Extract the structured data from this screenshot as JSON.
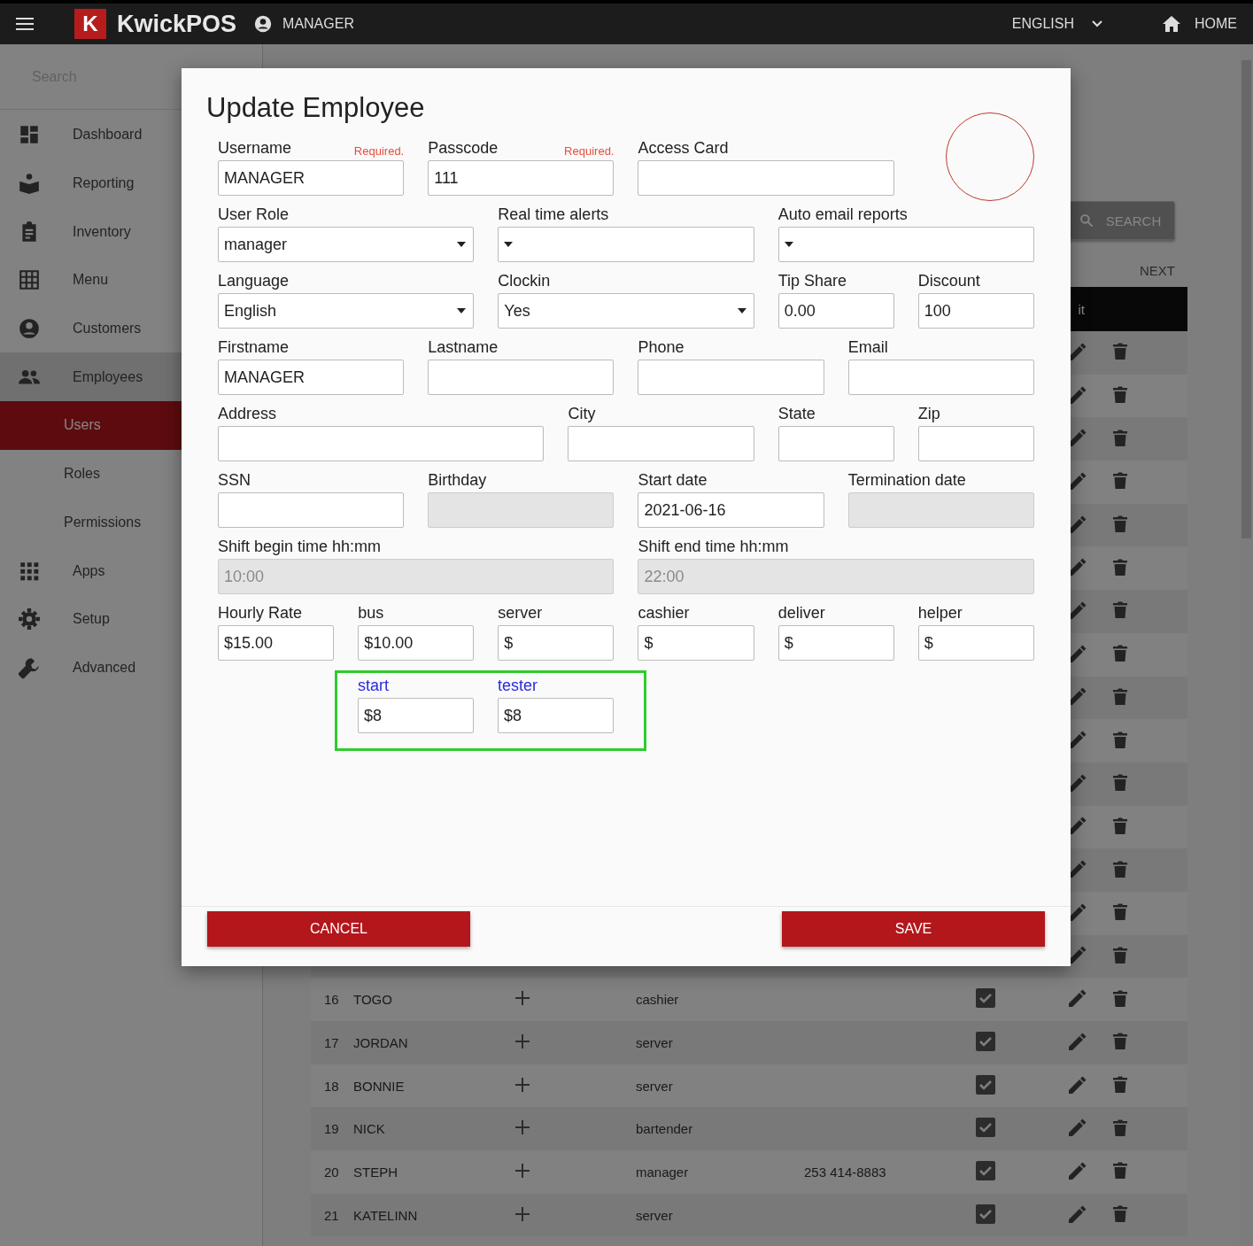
{
  "topbar": {
    "brand_letter": "K",
    "brand": "KwickPOS",
    "user": "MANAGER",
    "language": "ENGLISH",
    "home": "HOME"
  },
  "sidebar": {
    "search": {
      "placeholder": "Search"
    },
    "items": [
      {
        "label": "Dashboard"
      },
      {
        "label": "Reporting"
      },
      {
        "label": "Inventory"
      },
      {
        "label": "Menu"
      },
      {
        "label": "Customers"
      },
      {
        "label": "Employees",
        "expanded": true,
        "children": [
          {
            "label": "Users",
            "selected": true
          },
          {
            "label": "Roles",
            "selected": false
          },
          {
            "label": "Permissions",
            "selected": false
          }
        ]
      },
      {
        "label": "Apps"
      },
      {
        "label": "Setup"
      },
      {
        "label": "Advanced"
      }
    ]
  },
  "main": {
    "search_button": "SEARCH",
    "next": "NEXT",
    "table": {
      "header": "it",
      "rows": [
        {
          "number": "16",
          "name": "TOGO",
          "role": "cashier",
          "checked": true
        },
        {
          "number": "17",
          "name": "JORDAN",
          "role": "server",
          "checked": true
        },
        {
          "number": "18",
          "name": "BONNIE",
          "role": "server",
          "checked": true
        },
        {
          "number": "19",
          "name": "NICK",
          "role": "bartender",
          "checked": true
        },
        {
          "number": "20",
          "name": "STEPH",
          "role": "manager",
          "phone": "253 414-8883",
          "checked": true
        },
        {
          "number": "21",
          "name": "KATELINN",
          "role": "server",
          "checked": true
        }
      ]
    }
  },
  "dialog": {
    "title": "Update Employee",
    "fields": [
      {
        "label": "Username",
        "note": "Required.",
        "kind": "text",
        "value": "MANAGER",
        "disabled": false
      },
      {
        "label": "Passcode",
        "note": "Required.",
        "kind": "text",
        "value": "111",
        "disabled": false
      },
      {
        "label": "Access Card",
        "kind": "text",
        "disabled": false
      },
      {
        "label": "User Role",
        "kind": "select",
        "value": "manager",
        "disabled": false
      },
      {
        "label": "Real time alerts",
        "kind": "select",
        "disabled": false
      },
      {
        "label": "Auto email reports",
        "kind": "select",
        "disabled": false
      },
      {
        "label": "Language",
        "kind": "select",
        "value": "English",
        "disabled": false
      },
      {
        "label": "Clockin",
        "kind": "select",
        "value": "Yes",
        "disabled": false
      },
      {
        "label": "Tip Share",
        "kind": "text",
        "value": "0.00",
        "disabled": false
      },
      {
        "label": "Discount",
        "kind": "text",
        "value": "100",
        "disabled": false
      },
      {
        "label": "Firstname",
        "kind": "text",
        "value": "MANAGER",
        "disabled": false
      },
      {
        "label": "Lastname",
        "kind": "text",
        "disabled": false
      },
      {
        "label": "Phone",
        "kind": "text",
        "disabled": false
      },
      {
        "label": "Email",
        "kind": "text",
        "disabled": false
      },
      {
        "label": "Address",
        "kind": "text",
        "disabled": false
      },
      {
        "label": "City",
        "kind": "text",
        "disabled": false
      },
      {
        "label": "State",
        "kind": "text",
        "disabled": false
      },
      {
        "label": "Zip",
        "kind": "text",
        "disabled": false
      },
      {
        "label": "SSN",
        "kind": "text",
        "disabled": false
      },
      {
        "label": "Birthday",
        "kind": "text",
        "disabled": true
      },
      {
        "label": "Start date",
        "kind": "text",
        "value": "2021-06-16",
        "disabled": false
      },
      {
        "label": "Termination date",
        "kind": "text",
        "disabled": true
      },
      {
        "label": "Shift begin time hh:mm",
        "kind": "text",
        "value": "10:00",
        "disabled": true
      },
      {
        "label": "Shift end time hh:mm",
        "kind": "text",
        "value": "22:00",
        "disabled": true
      },
      {
        "label": "Hourly Rate",
        "kind": "text",
        "value": "$15.00",
        "disabled": false
      },
      {
        "label": "bus",
        "kind": "text",
        "value": "$10.00",
        "disabled": false
      },
      {
        "label": "server",
        "kind": "text",
        "value": "$",
        "disabled": false
      },
      {
        "label": "cashier",
        "kind": "text",
        "value": "$",
        "disabled": false
      },
      {
        "label": "deliver",
        "kind": "text",
        "value": "$",
        "disabled": false
      },
      {
        "label": "helper",
        "kind": "text",
        "value": "$",
        "disabled": false
      }
    ],
    "custom_rates": {
      "highlighted": true,
      "fields": [
        {
          "label": "start",
          "kind": "text",
          "value": "$8",
          "disabled": false
        },
        {
          "label": "tester",
          "kind": "text",
          "value": "$8",
          "disabled": false
        }
      ]
    },
    "buttons": [
      {
        "label": "CANCEL"
      },
      {
        "label": "SAVE"
      }
    ]
  }
}
